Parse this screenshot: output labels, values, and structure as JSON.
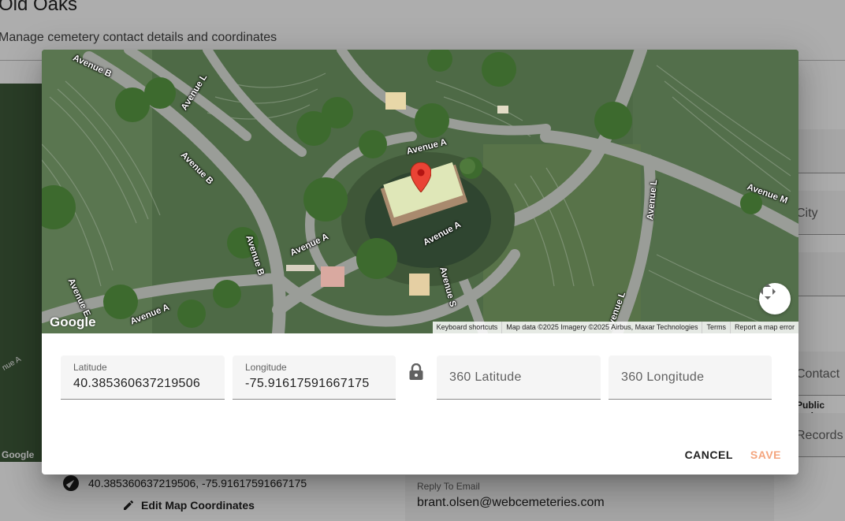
{
  "page": {
    "title": "Old Oaks",
    "subtitle": "Manage cemetery contact details and coordinates",
    "side_fields": [
      "City",
      "Contact",
      "Records"
    ],
    "public_tools": "Public tools",
    "coordinates_text": "40.385360637219506, -75.91617591667175",
    "edit_map_label": "Edit Map Coordinates",
    "reply_email_label": "Reply To Email",
    "reply_email_value": "brant.olsen@webcemeteries.com",
    "bg_map_google": "Google",
    "bg_map_road": "nue A"
  },
  "dialog": {
    "map": {
      "road_labels": [
        "Avenue B",
        "Avenue L",
        "Avenue B",
        "Avenue A",
        "Avenue M",
        "Avenue L",
        "Avenue A",
        "Avenue B",
        "Avenue A",
        "Avenue S",
        "Avenue E",
        "Avenue A",
        "Avenue L"
      ],
      "google_logo": "Google",
      "attribution": {
        "shortcuts": "Keyboard shortcuts",
        "map_data": "Map data ©2025 Imagery ©2025 Airbus, Maxar Technologies",
        "terms": "Terms",
        "report": "Report a map error"
      }
    },
    "fields": {
      "latitude": {
        "label": "Latitude",
        "value": "40.385360637219506"
      },
      "longitude": {
        "label": "Longitude",
        "value": "-75.91617591667175"
      },
      "lat360": {
        "placeholder": "360 Latitude"
      },
      "lon360": {
        "placeholder": "360 Longitude"
      }
    },
    "actions": {
      "cancel": "CANCEL",
      "save": "SAVE"
    },
    "colors": {
      "save_accent": "#f4a57e",
      "marker": "#ea4335"
    }
  }
}
